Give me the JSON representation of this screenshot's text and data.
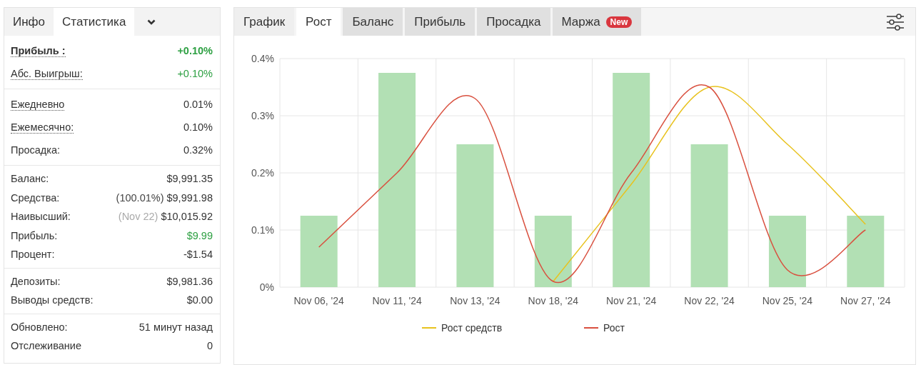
{
  "left_tabs": [
    {
      "label": "Инфо",
      "selected": false
    },
    {
      "label": "Статистика",
      "selected": true
    }
  ],
  "stats_sections": [
    [
      {
        "label": "Прибыль :",
        "value": "+0.10%",
        "dotted": true,
        "bold": true,
        "kind": "positive"
      },
      {
        "label": "Абс. Выигрыш:",
        "value": "+0.10%",
        "dotted": true,
        "bold": false,
        "kind": "positive"
      }
    ],
    [
      {
        "label": "Ежедневно",
        "value": "0.01%",
        "dotted": true,
        "bold": false,
        "kind": "plain"
      },
      {
        "label": "Ежемесячно:",
        "value": "0.10%",
        "dotted": true,
        "bold": false,
        "kind": "plain"
      },
      {
        "label": "Просадка:",
        "value": "0.32%",
        "dotted": false,
        "bold": false,
        "kind": "plain"
      }
    ],
    [
      {
        "label": "Баланс:",
        "value": "$9,991.35",
        "dotted": false,
        "bold": false,
        "kind": "plain"
      },
      {
        "label": "Средства:",
        "note": "(100.01%)",
        "note_muted": false,
        "value": "$9,991.98",
        "dotted": false,
        "bold": false,
        "kind": "plain"
      },
      {
        "label": "Наивысший:",
        "note": "(Nov 22)",
        "note_muted": true,
        "value": "$10,015.92",
        "dotted": false,
        "bold": false,
        "kind": "plain"
      },
      {
        "label": "Прибыль:",
        "value": "$9.99",
        "dotted": false,
        "bold": false,
        "kind": "positive"
      },
      {
        "label": "Процент:",
        "value": "-$1.54",
        "dotted": false,
        "bold": false,
        "kind": "plain"
      }
    ],
    [
      {
        "label": "Депозиты:",
        "value": "$9,981.36",
        "dotted": false,
        "bold": false,
        "kind": "plain"
      },
      {
        "label": "Выводы средств:",
        "value": "$0.00",
        "dotted": false,
        "bold": false,
        "kind": "plain"
      }
    ],
    [
      {
        "label": "Обновлено:",
        "value": "51 минут назад",
        "dotted": false,
        "bold": false,
        "kind": "plain"
      },
      {
        "label": "Отслеживание",
        "value": "0",
        "dotted": false,
        "bold": false,
        "kind": "plain"
      }
    ]
  ],
  "chart_tabs": [
    {
      "label": "График",
      "selected": false,
      "kind": "plain"
    },
    {
      "label": "Рост",
      "selected": true,
      "kind": "plain"
    },
    {
      "label": "Баланс",
      "selected": false,
      "kind": "shaded"
    },
    {
      "label": "Прибыль",
      "selected": false,
      "kind": "shaded"
    },
    {
      "label": "Просадка",
      "selected": false,
      "kind": "shaded"
    },
    {
      "label": "Маржа",
      "badge": "New",
      "selected": false,
      "kind": "shaded"
    }
  ],
  "chart_data": {
    "type": "bar",
    "categories": [
      "Nov 06, '24",
      "Nov 11, '24",
      "Nov 13, '24",
      "Nov 18, '24",
      "Nov 21, '24",
      "Nov 22, '24",
      "Nov 25, '24",
      "Nov 27, '24"
    ],
    "values": [
      0.125,
      0.375,
      0.25,
      0.125,
      0.375,
      0.25,
      0.125,
      0.125
    ],
    "series": [
      {
        "name": "Рост средств",
        "type": "line",
        "color": "#e8c21e",
        "values": [
          null,
          null,
          null,
          0.01,
          0.18,
          0.35,
          0.25,
          0.11
        ]
      },
      {
        "name": "Рост",
        "type": "line",
        "color": "#d9503f",
        "values": [
          0.07,
          0.2,
          0.33,
          0.01,
          0.2,
          0.35,
          0.03,
          0.1
        ]
      }
    ],
    "grid": true,
    "legend": "bottom",
    "ylim": [
      0,
      0.4
    ],
    "yticks": [
      {
        "value": 0,
        "label": "0%"
      },
      {
        "value": 0.1,
        "label": "0.1%"
      },
      {
        "value": 0.2,
        "label": "0.2%"
      },
      {
        "value": 0.3,
        "label": "0.3%"
      },
      {
        "value": 0.4,
        "label": "0.4%"
      }
    ]
  }
}
